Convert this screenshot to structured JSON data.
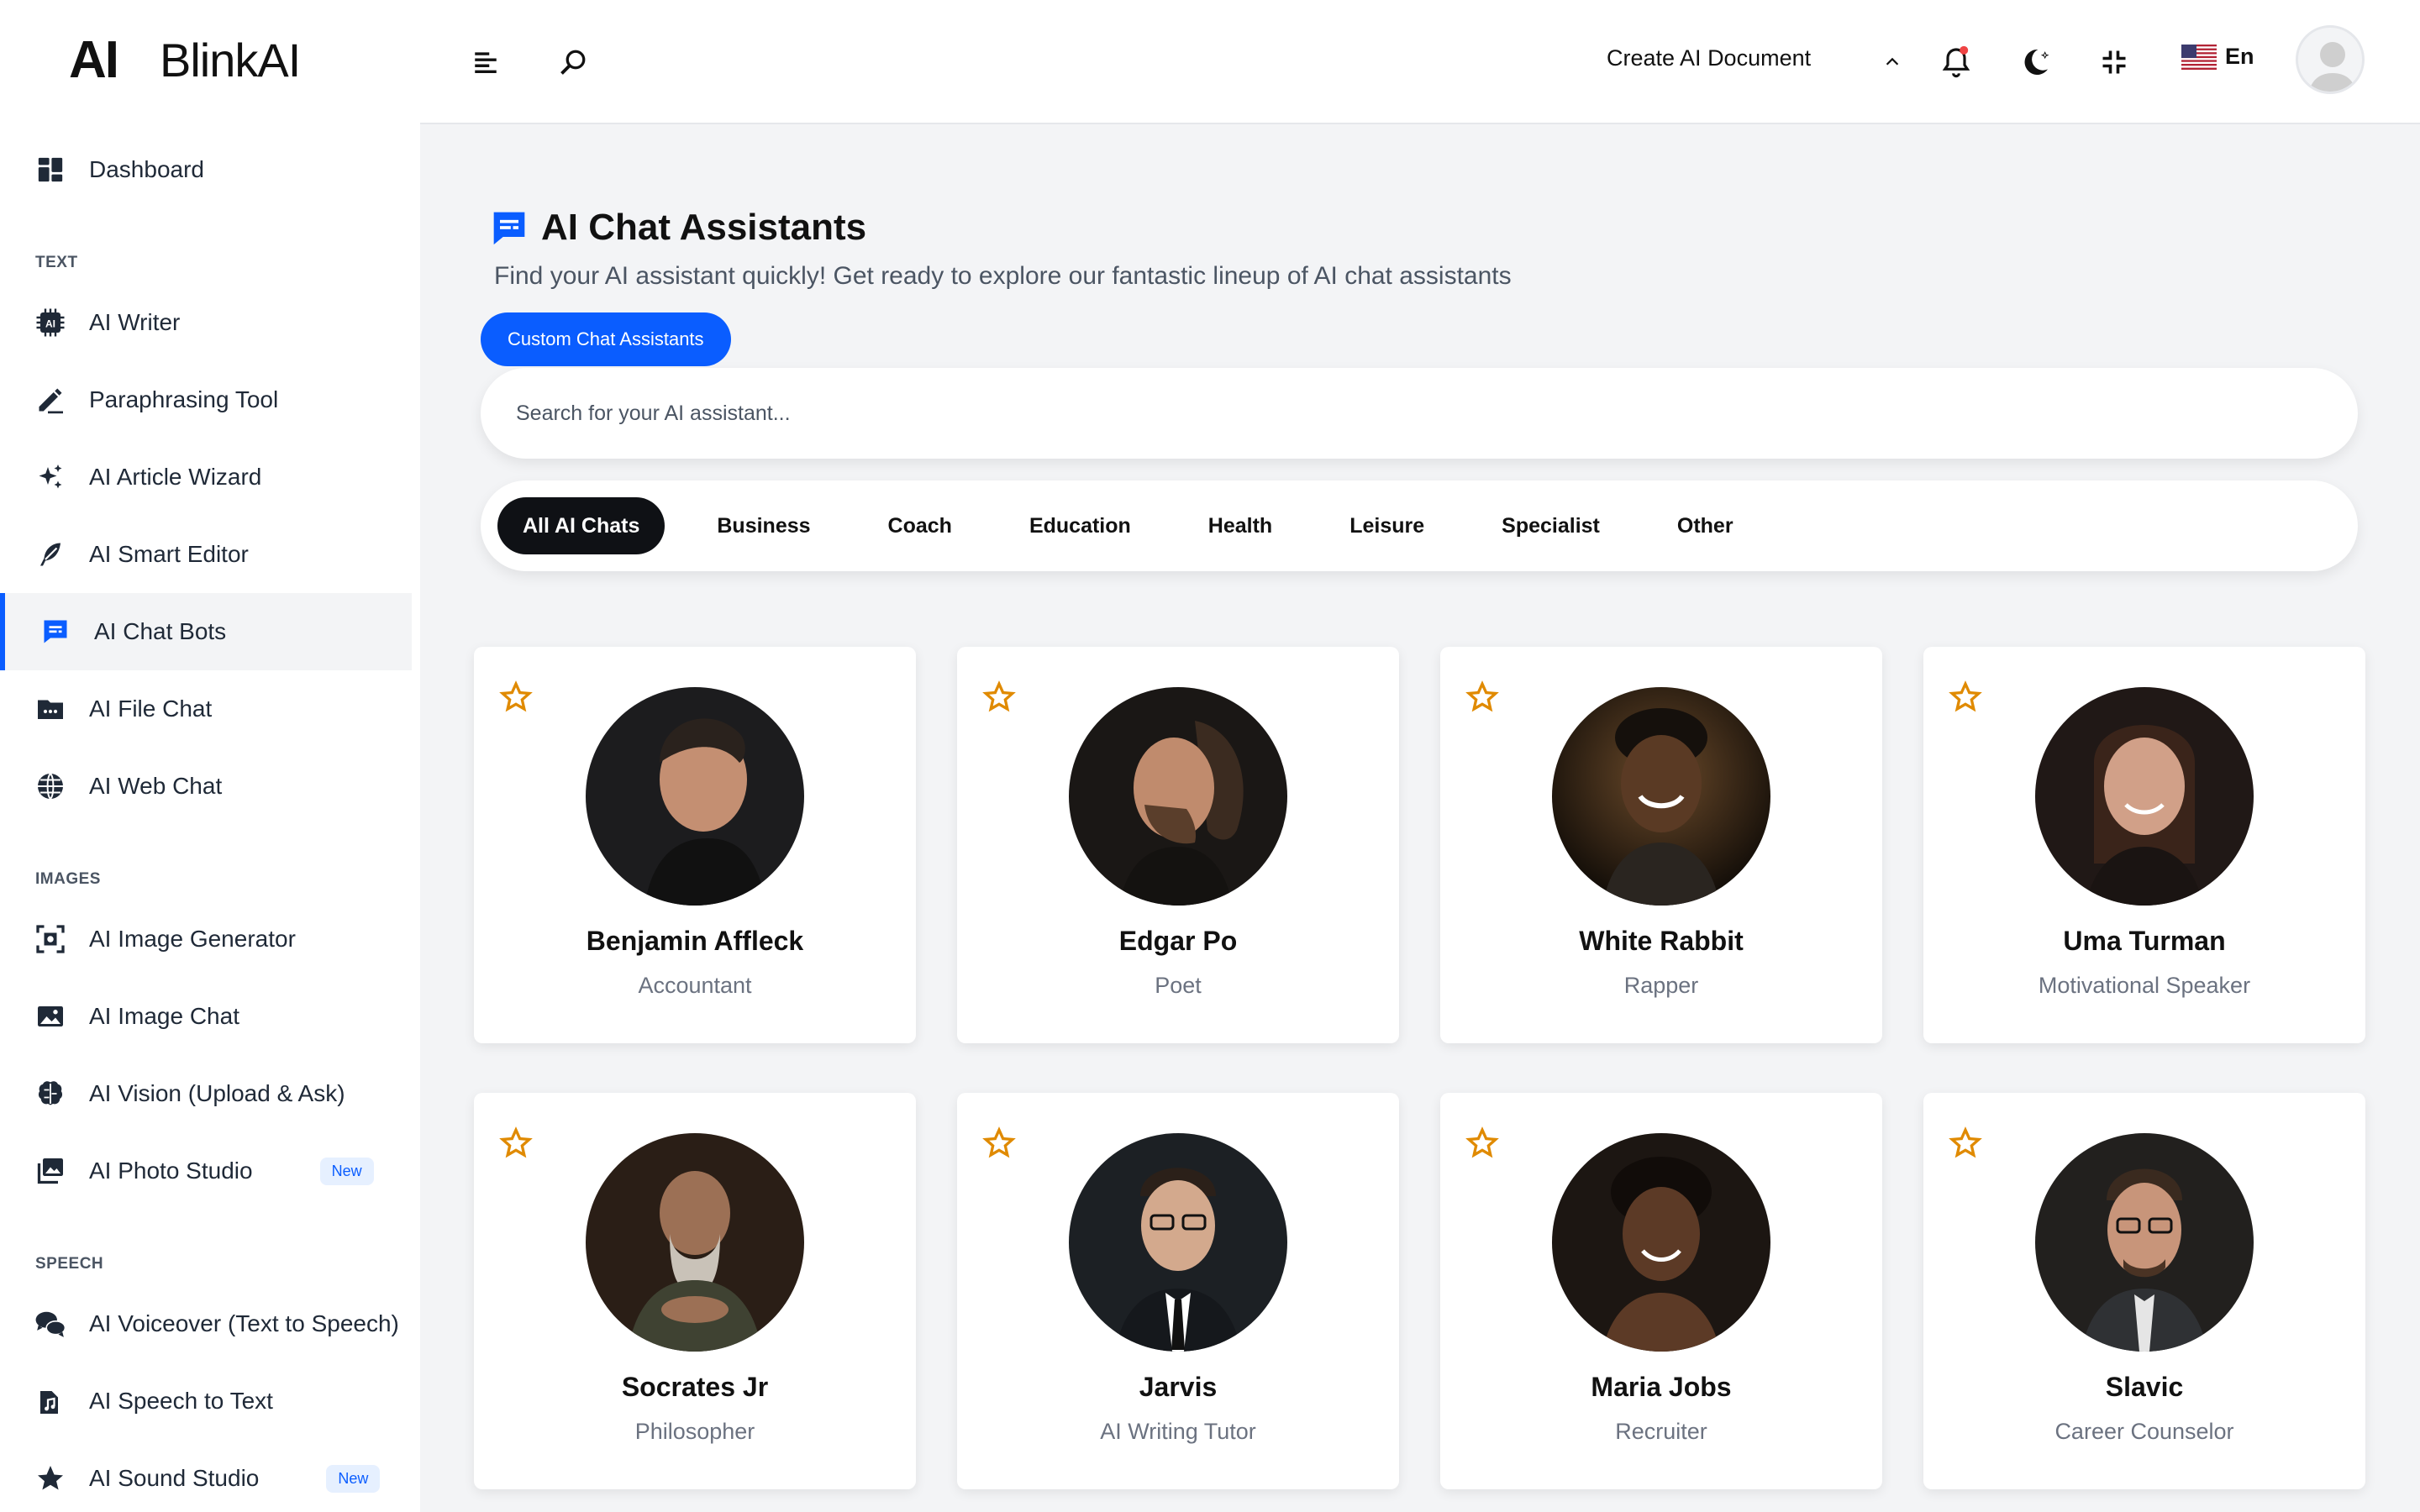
{
  "brand": {
    "mark": "AI",
    "name": "BlinkAI"
  },
  "sidebar": {
    "dashboard": "Dashboard",
    "sections": {
      "text": "TEXT",
      "images": "IMAGES",
      "speech": "SPEECH"
    },
    "text_items": [
      {
        "label": "AI Writer",
        "icon": "ai-chip-icon"
      },
      {
        "label": "Paraphrasing Tool",
        "icon": "pen-icon"
      },
      {
        "label": "AI Article Wizard",
        "icon": "sparkle-icon"
      },
      {
        "label": "AI Smart Editor",
        "icon": "feather-icon"
      },
      {
        "label": "AI Chat Bots",
        "icon": "chat-icon",
        "active": true
      },
      {
        "label": "AI File Chat",
        "icon": "folder-icon"
      },
      {
        "label": "AI Web Chat",
        "icon": "globe-icon"
      }
    ],
    "image_items": [
      {
        "label": "AI Image Generator",
        "icon": "image-scan-icon"
      },
      {
        "label": "AI Image Chat",
        "icon": "image-icon"
      },
      {
        "label": "AI Vision (Upload & Ask)",
        "icon": "brain-icon"
      },
      {
        "label": "AI Photo Studio",
        "icon": "photos-icon",
        "badge": "New"
      }
    ],
    "speech_items": [
      {
        "label": "AI Voiceover (Text to Speech)",
        "icon": "chat-bubbles-icon"
      },
      {
        "label": "AI Speech to Text",
        "icon": "music-file-icon"
      },
      {
        "label": "AI Sound Studio",
        "icon": "star-icon",
        "badge": "New"
      }
    ]
  },
  "topbar": {
    "create_doc": "Create AI Document",
    "lang": "En"
  },
  "page": {
    "title": "AI Chat Assistants",
    "subtitle": "Find your AI assistant quickly! Get ready to explore our fantastic lineup of AI chat assistants",
    "custom_button": "Custom Chat Assistants",
    "search_placeholder": "Search for your AI assistant...",
    "tabs": [
      "All AI Chats",
      "Business",
      "Coach",
      "Education",
      "Health",
      "Leisure",
      "Specialist",
      "Other"
    ],
    "active_tab": "All AI Chats"
  },
  "assistants": [
    {
      "name": "Benjamin Affleck",
      "role": "Accountant"
    },
    {
      "name": "Edgar Po",
      "role": "Poet"
    },
    {
      "name": "White Rabbit",
      "role": "Rapper"
    },
    {
      "name": "Uma Turman",
      "role": "Motivational Speaker"
    },
    {
      "name": "Socrates Jr",
      "role": "Philosopher"
    },
    {
      "name": "Jarvis",
      "role": "AI Writing Tutor"
    },
    {
      "name": "Maria Jobs",
      "role": "Recruiter"
    },
    {
      "name": "Slavic",
      "role": "Career Counselor"
    }
  ],
  "colors": {
    "accent": "#0a5dff",
    "star": "#e08a00",
    "notification_dot": "#ef4444",
    "active_tab_bg": "#0f1115"
  }
}
